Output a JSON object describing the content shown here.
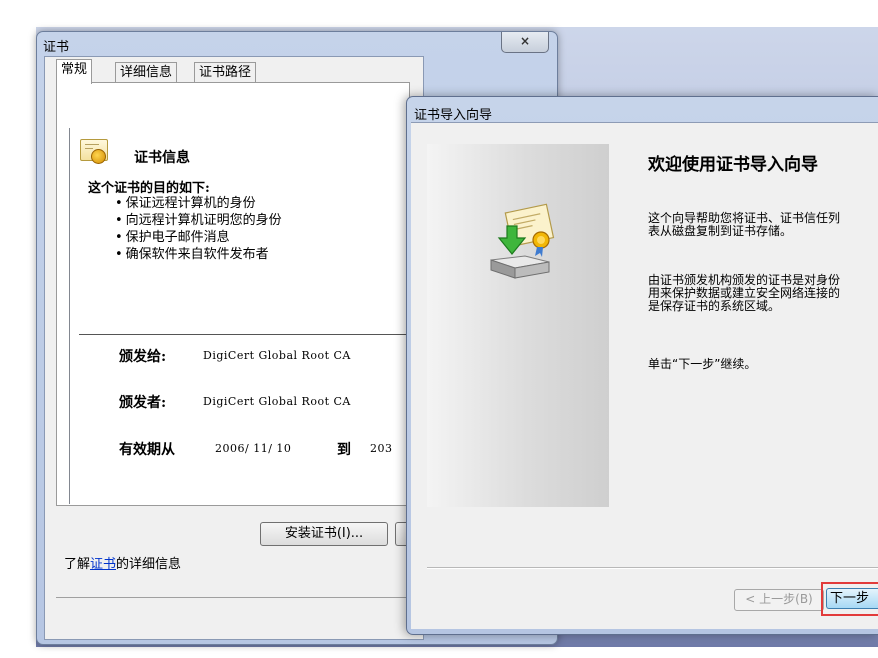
{
  "cert_window": {
    "title": "证书",
    "close_icon": "×",
    "tabs": [
      "常规",
      "详细信息",
      "证书路径"
    ],
    "info_heading": "证书信息",
    "purpose_heading": "这个证书的目的如下:",
    "purposes": [
      "保证远程计算机的身份",
      "向远程计算机证明您的身份",
      "保护电子邮件消息",
      "确保软件来自软件发布者"
    ],
    "issued_to_label": "颁发给:",
    "issued_to_value": "DigiCert Global Root CA",
    "issued_by_label": "颁发者:",
    "issued_by_value": "DigiCert Global Root CA",
    "valid_from_label": "有效期从",
    "valid_from_date": "2006/ 11/ 10",
    "valid_to_word": "到",
    "valid_to_date": "203",
    "install_button": "安装证书(I)...",
    "learn_more_prefix": "了解",
    "learn_more_link": "证书",
    "learn_more_suffix": "的详细信息"
  },
  "wizard": {
    "title": "证书导入向导",
    "heading": "欢迎使用证书导入向导",
    "para1_line1": "这个向导帮助您将证书、证书信任列",
    "para1_line2": "表从磁盘复制到证书存储。",
    "para2_line1": "由证书颁发机构颁发的证书是对身份",
    "para2_line2": "用来保护数据或建立安全网络连接的",
    "para2_line3": "是保存证书的系统区域。",
    "para3": "单击“下一步”继续。",
    "back_button": "< 上一步(B)",
    "next_button": "下一步"
  },
  "icons": {
    "certificate": "certificate-icon",
    "import": "import-certificate-icon"
  },
  "colors": {
    "highlight": "#e23b3b",
    "link": "#0033cc"
  }
}
